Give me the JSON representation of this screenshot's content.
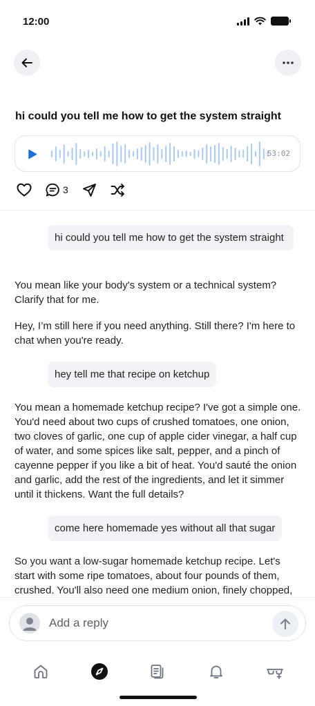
{
  "status_bar": {
    "time": "12:00",
    "icons": [
      "signal-icon",
      "wifi-icon",
      "battery-icon"
    ]
  },
  "header": {
    "back_icon": "arrow-left-icon",
    "more_icon": "ellipsis-icon"
  },
  "post": {
    "title": "hi could you tell me how to get the system straight",
    "audio": {
      "play_icon": "play-icon",
      "duration": "53:02"
    },
    "actions": {
      "like_icon": "heart-icon",
      "comment_icon": "comment-icon",
      "comment_count": "3",
      "share_icon": "send-icon",
      "remix_icon": "shuffle-icon"
    }
  },
  "conversation": {
    "messages": [
      {
        "role": "user",
        "text": "hi could you tell me how to get the system straight"
      },
      {
        "role": "ai",
        "text": "You mean like your body's system or a technical system? Clarify that for me."
      },
      {
        "role": "ai",
        "text": "Hey, I’m still here if you need anything. Still there? I'm here to chat when you're ready."
      },
      {
        "role": "user",
        "text": "hey tell me that recipe on ketchup"
      },
      {
        "role": "ai",
        "text": "You mean a homemade ketchup recipe? I've got a simple one. You'd need about two cups of crushed tomatoes, one onion, two cloves of garlic, one cup of apple cider vinegar, a half cup of water, and some spices like salt, pepper, and a pinch of cayenne pepper if you like a bit of heat. You'd sauté the onion and garlic, add the rest of the ingredients, and let it simmer until it thickens. Want the full details?"
      },
      {
        "role": "user",
        "text": "come here homemade yes without all that sugar"
      },
      {
        "role": "ai",
        "text": "So you want a low-sugar homemade ketchup recipe. Let's start with some ripe tomatoes, about four pounds of them, crushed. You'll also need one medium onion, finely chopped,"
      }
    ]
  },
  "reply": {
    "placeholder": "Add a reply",
    "avatar_icon": "user-avatar-icon",
    "send_icon": "arrow-up-icon"
  },
  "tab_bar": {
    "tabs": [
      {
        "icon": "home-icon",
        "active": false
      },
      {
        "icon": "compass-icon",
        "active": true
      },
      {
        "icon": "threads-icon",
        "active": false
      },
      {
        "icon": "bell-icon",
        "active": false
      },
      {
        "icon": "glasses-icon",
        "active": false
      }
    ]
  },
  "colors": {
    "accent": "#1d6fe0",
    "waveform": "#a9c9f2",
    "bubble": "#f1f3f6"
  }
}
